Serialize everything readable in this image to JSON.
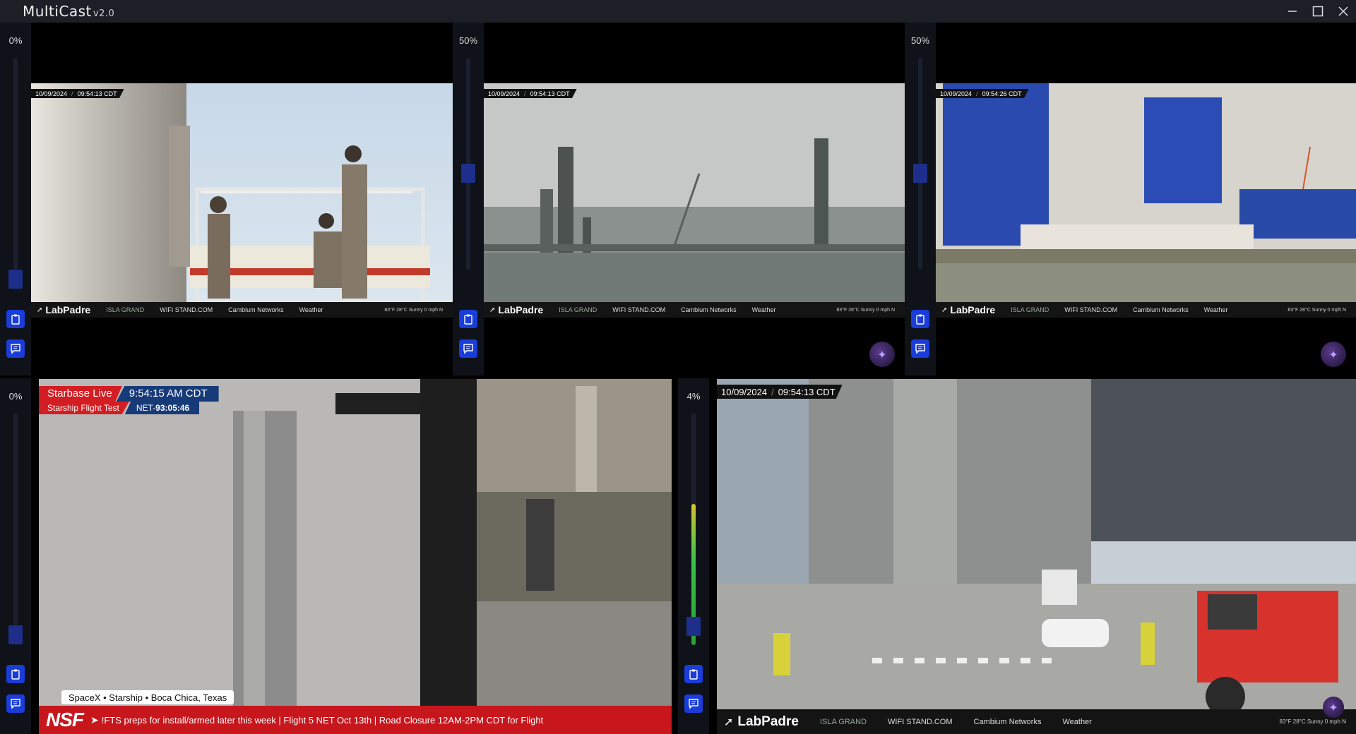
{
  "app": {
    "title": "MultiCast",
    "version": "v2.0",
    "window_controls": [
      "minimize-icon",
      "maximize-icon",
      "close-icon"
    ]
  },
  "colors": {
    "titlebar": "#1c1f26",
    "accent_button": "#1a3cd8",
    "slider_thumb": "#1d2f8a",
    "nsf_red": "#d21e23",
    "nsf_blue": "#173a78"
  },
  "panels": [
    {
      "volume_label": "0%",
      "volume": 0,
      "timestamp_date": "10/09/2024",
      "timestamp_time": "09:54:13 CDT",
      "overlay": {
        "brand": "LabPadre",
        "sponsors": [
          "ISLA GRAND",
          "WIFI STAND.COM",
          "Cambium Networks",
          "Weather"
        ],
        "weather": "83°F 28°C Sunny 0 mph N"
      }
    },
    {
      "volume_label": "50%",
      "volume": 50,
      "timestamp_date": "10/09/2024",
      "timestamp_time": "09:54:13 CDT",
      "overlay": {
        "brand": "LabPadre",
        "sponsors": [
          "ISLA GRAND",
          "WIFI STAND.COM",
          "Cambium Networks",
          "Weather"
        ],
        "weather": "83°F 28°C Sunny 0 mph N"
      }
    },
    {
      "volume_label": "50%",
      "volume": 50,
      "timestamp_date": "10/09/2024",
      "timestamp_time": "09:54:26 CDT",
      "overlay": {
        "brand": "LabPadre",
        "sponsors": [
          "ISLA GRAND",
          "WIFI STAND.COM",
          "Cambium Networks",
          "Weather"
        ],
        "weather": "83°F 28°C Sunny 0 mph N"
      }
    },
    {
      "volume_label": "0%",
      "volume": 0,
      "nsf": {
        "live_label": "Starbase Live",
        "time": "9:54:15 AM CDT",
        "program": "Starship Flight Test",
        "net_prefix": "NET-",
        "net_countdown": "93:05:46",
        "location": "SpaceX  •  Starship  •  Boca Chica, Texas",
        "logo": "NSF",
        "ticker": "!FTS preps for install/armed later this week | Flight 5 NET Oct 13th | Road Closure 12AM-2PM CDT for Flight"
      }
    },
    {
      "volume_label": "4%",
      "volume": 4,
      "timestamp_date": "10/09/2024",
      "timestamp_time": "09:54:13 CDT",
      "overlay": {
        "brand": "LabPadre",
        "sponsors": [
          "ISLA GRAND",
          "WIFI STAND.COM",
          "Cambium Networks",
          "Weather"
        ],
        "weather": "83°F 28°C Sunny 0 mph N"
      }
    }
  ]
}
